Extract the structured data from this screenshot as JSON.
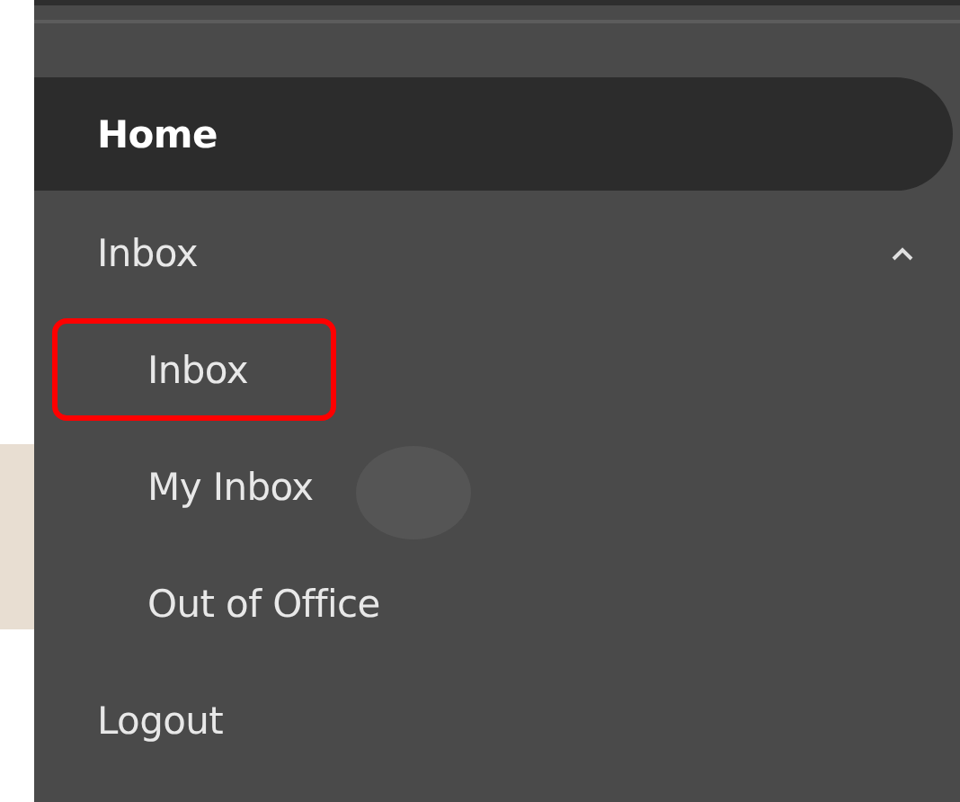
{
  "nav": [
    {
      "kind": "link",
      "label": "Home",
      "selected": true
    },
    {
      "kind": "group",
      "label": "Inbox",
      "selected": false,
      "expanded": true,
      "children": [
        {
          "label": "Inbox",
          "highlighted": true
        },
        {
          "label": "My Inbox",
          "highlighted": false
        },
        {
          "label": "Out of Office",
          "highlighted": false
        }
      ]
    },
    {
      "kind": "link",
      "label": "Logout",
      "selected": false
    }
  ]
}
